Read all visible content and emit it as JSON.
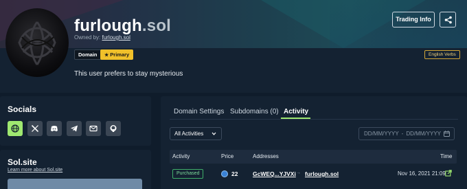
{
  "profile": {
    "name": "furlough",
    "tld": ".sol",
    "owned_by_prefix": "Owned by:",
    "owner": "furlough.sol",
    "bio": "This user prefers to stay mysterious"
  },
  "badges": {
    "domain": "Domain",
    "primary": "Primary",
    "language": "English Verbs"
  },
  "header_actions": {
    "trading_info": "Trading Info",
    "share_icon": "share-icon"
  },
  "socials": {
    "title": "Socials",
    "icons": [
      "globe-icon",
      "x-icon",
      "discord-icon",
      "telegram-icon",
      "email-icon",
      "github-icon"
    ]
  },
  "solsite": {
    "title": "Sol.site",
    "link": "Learn more about Sol.site"
  },
  "tabs": {
    "items": [
      "Domain Settings",
      "Subdomains (0)",
      "Activity"
    ],
    "active": "Activity"
  },
  "filters": {
    "activity_select": "All Activities",
    "date_from_placeholder": "DD/MM/YYYY",
    "date_to_placeholder": "DD/MM/YYYY",
    "date_separator": "-"
  },
  "table": {
    "columns": {
      "activity": "Activity",
      "price": "Price",
      "addresses": "Addresses",
      "time": "Time"
    },
    "rows": [
      {
        "activity": "Purchased",
        "price": "22",
        "from": "GcWEQ...YJVXi",
        "to": "furlough.sol",
        "time": "Nov 16, 2021 21:09"
      }
    ]
  },
  "colors": {
    "accent": "#9fe870",
    "primary_badge": "#f0c02a",
    "background": "#0f1c2b",
    "panel": "#142232"
  }
}
